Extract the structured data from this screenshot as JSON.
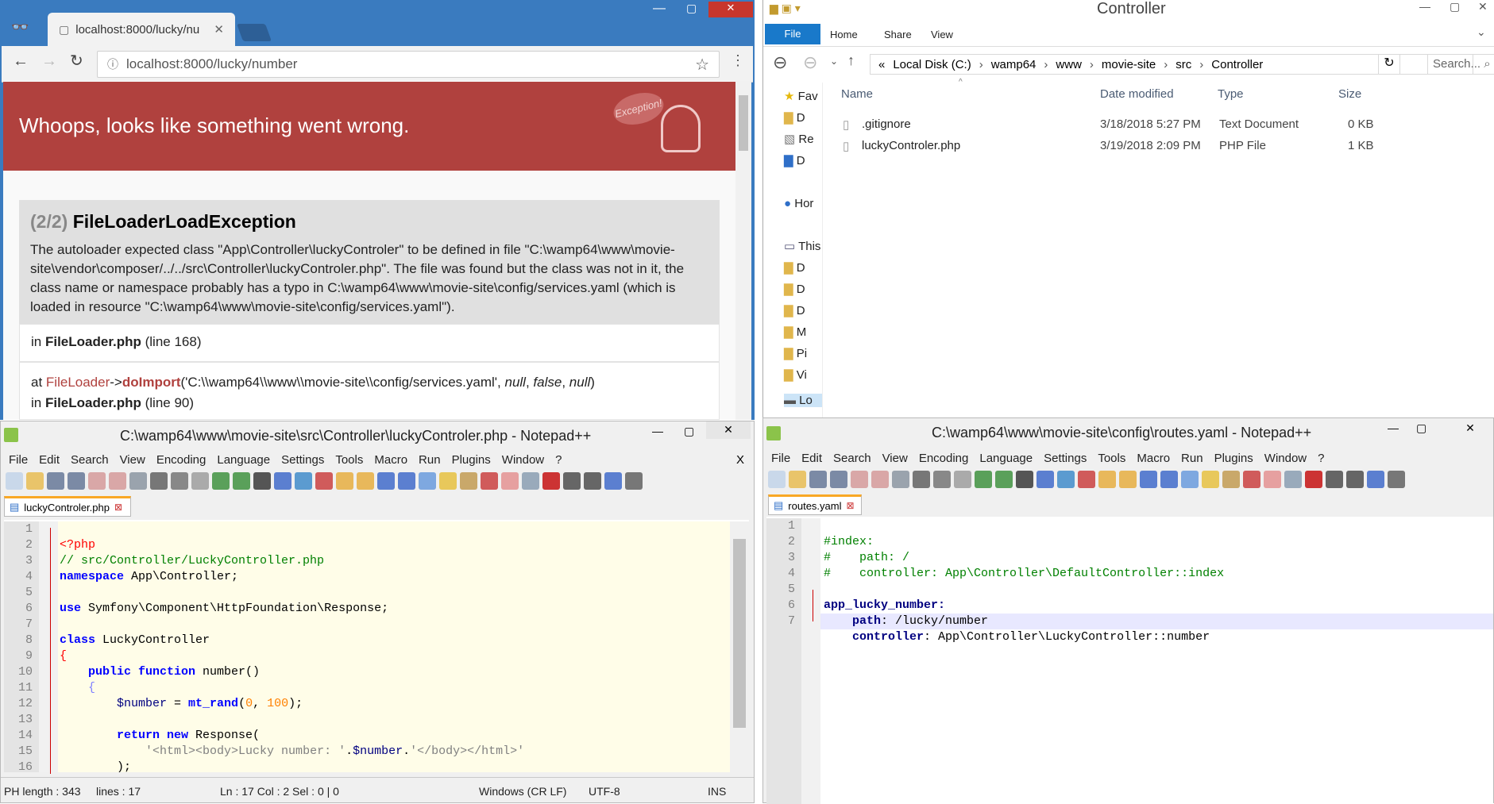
{
  "browser": {
    "tab_title": "localhost:8000/lucky/nu",
    "url": "localhost:8000/lucky/number",
    "banner_text": "Whoops, looks like something went wrong.",
    "exception_badge": "Exception!",
    "exception": {
      "counter": "(2/2)",
      "name": "FileLoaderLoadException",
      "message": "The autoloader expected class \"App\\Controller\\luckyControler\" to be defined in file \"C:\\wamp64\\www\\movie-site\\vendor\\composer/../../src\\Controller\\luckyControler.php\". The file was found but the class was not in it, the class name or namespace probably has a typo in C:\\wamp64\\www\\movie-site\\config/services.yaml (which is loaded in resource \"C:\\wamp64\\www\\movie-site\\config/services.yaml\")."
    },
    "trace": [
      {
        "prefix": "in",
        "file": "FileLoader.php",
        "line": "(line 168)"
      },
      {
        "at": "at",
        "class": "FileLoader",
        "arrow": "->",
        "method": "doImport",
        "args_open": "('C:\\\\wamp64\\\\www\\\\movie-site\\\\config/services.yaml', ",
        "arg1": "null",
        "sep1": ", ",
        "arg2": "false",
        "sep2": ", ",
        "arg3": "null",
        "args_close": ")",
        "prefix": "in",
        "file": "FileLoader.php",
        "line": "(line 90)"
      }
    ]
  },
  "explorer": {
    "title": "Controller",
    "ribbon_tabs": [
      "File",
      "Home",
      "Share",
      "View"
    ],
    "breadcrumb": [
      "«",
      "Local Disk (C:)",
      "wamp64",
      "www",
      "movie-site",
      "src",
      "Controller"
    ],
    "search_placeholder": "Search...",
    "columns": [
      "Name",
      "Date modified",
      "Type",
      "Size"
    ],
    "files": [
      {
        "name": ".gitignore",
        "date": "3/18/2018 5:27 PM",
        "type": "Text Document",
        "size": "0 KB"
      },
      {
        "name": "luckyControler.php",
        "date": "3/19/2018 2:09 PM",
        "type": "PHP File",
        "size": "1 KB"
      }
    ],
    "nav": [
      "Fav",
      "D",
      "Re",
      "D",
      "Hor",
      "This",
      "D",
      "D",
      "D",
      "M",
      "Pi",
      "Vi",
      "Lo"
    ]
  },
  "npp_left": {
    "title": "C:\\wamp64\\www\\movie-site\\src\\Controller\\luckyControler.php - Notepad++",
    "menu": [
      "File",
      "Edit",
      "Search",
      "View",
      "Encoding",
      "Language",
      "Settings",
      "Tools",
      "Macro",
      "Run",
      "Plugins",
      "Window",
      "?"
    ],
    "close_x": "X",
    "tab": "luckyControler.php",
    "line_numbers": [
      "1",
      "2",
      "3",
      "4",
      "5",
      "6",
      "7",
      "8",
      "9",
      "10",
      "11",
      "12",
      "13",
      "14",
      "15",
      "16"
    ],
    "code": {
      "l1": "<?php",
      "l2": "// src/Controller/LuckyController.php",
      "l3_kw": "namespace",
      "l3_rest": " App\\Controller;",
      "l5_kw": "use",
      "l5_rest": " Symfony\\Component\\HttpFoundation\\Response;",
      "l7_kw": "class",
      "l7_rest": " LuckyController",
      "l8": "{",
      "l9_kw": "public function",
      "l9_rest": " number()",
      "l10": "{",
      "l11_var": "$number",
      "l11_eq": " = ",
      "l11_fn": "mt_rand",
      "l11_o": "(",
      "l11_a": "0",
      "l11_c": ", ",
      "l11_b": "100",
      "l11_e": ");",
      "l13_kw": "return new",
      "l13_rest": " Response(",
      "l14_s1": "'<html><body>Lucky number: '",
      "l14_dot1": ".",
      "l14_var": "$number",
      "l14_dot2": ".",
      "l14_s2": "'</body></html>'",
      "l15": ");",
      "l16": "}"
    },
    "status": {
      "length": "PH length : 343",
      "lines": "lines : 17",
      "pos": "Ln : 17    Col : 2    Sel : 0 | 0",
      "eol": "Windows (CR LF)",
      "enc": "UTF-8",
      "mode": "INS"
    }
  },
  "npp_right": {
    "title": "C:\\wamp64\\www\\movie-site\\config\\routes.yaml - Notepad++",
    "menu": [
      "File",
      "Edit",
      "Search",
      "View",
      "Encoding",
      "Language",
      "Settings",
      "Tools",
      "Macro",
      "Run",
      "Plugins",
      "Window",
      "?"
    ],
    "tab": "routes.yaml",
    "line_numbers": [
      "1",
      "2",
      "3",
      "4",
      "5",
      "6",
      "7"
    ],
    "code": {
      "l1": "#index:",
      "l2": "#    path: /",
      "l3": "#    controller: App\\Controller\\DefaultController::index",
      "l5": "app_lucky_number:",
      "l6_k": "path",
      "l6_v": ": /lucky/number",
      "l7_k": "controller",
      "l7_v": ": App\\Controller\\LuckyController::number"
    }
  }
}
